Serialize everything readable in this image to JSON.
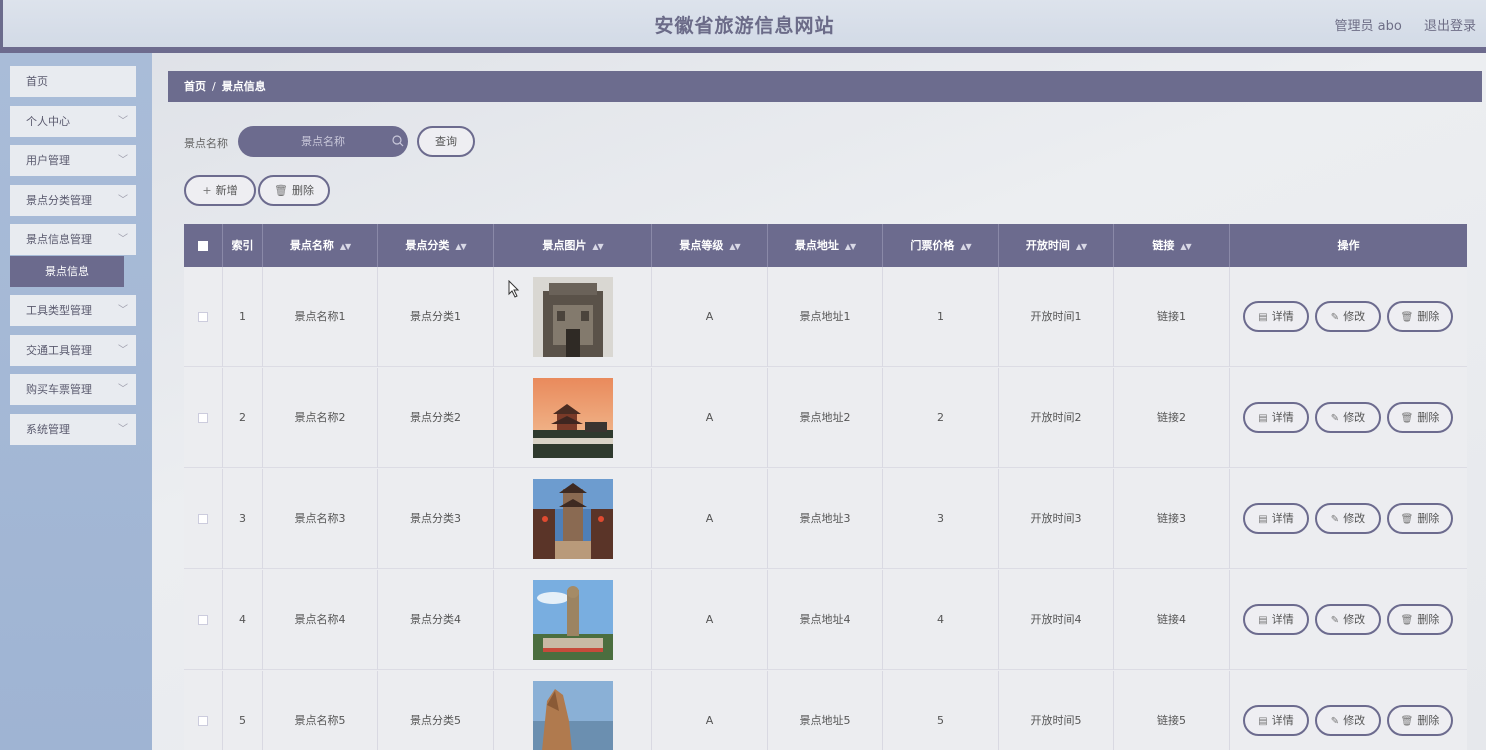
{
  "header": {
    "site_title": "安徽省旅游信息网站",
    "user_label": "管理员 abo",
    "logout_label": "退出登录"
  },
  "sidebar": {
    "items": [
      {
        "label": "首页"
      },
      {
        "label": "个人中心"
      },
      {
        "label": "用户管理"
      },
      {
        "label": "景点分类管理"
      },
      {
        "label": "景点信息管理"
      },
      {
        "label": "工具类型管理"
      },
      {
        "label": "交通工具管理"
      },
      {
        "label": "购买车票管理"
      },
      {
        "label": "系统管理"
      }
    ],
    "active_submenu": "景点信息"
  },
  "breadcrumb": {
    "home": "首页",
    "separator": "/",
    "current": "景点信息"
  },
  "search": {
    "label": "景点名称",
    "placeholder": "景点名称",
    "query_button": "查询"
  },
  "toolbar": {
    "add_label": "新增",
    "delete_label": "删除"
  },
  "table": {
    "columns": [
      "索引",
      "景点名称",
      "景点分类",
      "景点图片",
      "景点等级",
      "景点地址",
      "门票价格",
      "开放时间",
      "链接",
      "操作"
    ],
    "rows": [
      {
        "index": "1",
        "name": "景点名称1",
        "category": "景点分类1",
        "grade": "A",
        "address": "景点地址1",
        "price": "1",
        "hours": "开放时间1",
        "link": "链接1"
      },
      {
        "index": "2",
        "name": "景点名称2",
        "category": "景点分类2",
        "grade": "A",
        "address": "景点地址2",
        "price": "2",
        "hours": "开放时间2",
        "link": "链接2"
      },
      {
        "index": "3",
        "name": "景点名称3",
        "category": "景点分类3",
        "grade": "A",
        "address": "景点地址3",
        "price": "3",
        "hours": "开放时间3",
        "link": "链接3"
      },
      {
        "index": "4",
        "name": "景点名称4",
        "category": "景点分类4",
        "grade": "A",
        "address": "景点地址4",
        "price": "4",
        "hours": "开放时间4",
        "link": "链接4"
      },
      {
        "index": "5",
        "name": "景点名称5",
        "category": "景点分类5",
        "grade": "A",
        "address": "景点地址5",
        "price": "5",
        "hours": "开放时间5",
        "link": "链接5"
      }
    ],
    "actions": {
      "detail": "详情",
      "edit": "修改",
      "delete": "删除"
    }
  },
  "colors": {
    "accent": "#6c6b8e",
    "sidebar_bg": "#a9bcd8",
    "header_bg": "#dde3ec"
  },
  "icons": {
    "search": "search-icon",
    "add": "plus-icon",
    "delete": "trash-icon",
    "detail": "document-icon",
    "edit": "pencil-icon",
    "sort": "sort-icon",
    "chevron": "chevron-down-icon"
  }
}
